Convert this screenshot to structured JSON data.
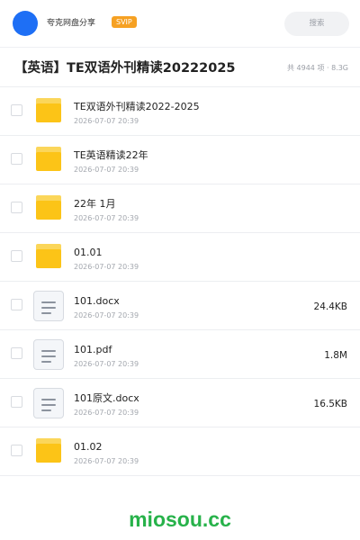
{
  "header": {
    "site_name": "夸克网盘分享",
    "badge": "SVIP",
    "search_label": "搜索"
  },
  "folder": {
    "title": "【英语】TE双语外刊精读20222025",
    "meta": "共 4944 项 · 8.3G"
  },
  "files": [
    {
      "type": "folder",
      "name": "TE双语外刊精读2022-2025",
      "date": "2026-07-07 20:39",
      "size": ""
    },
    {
      "type": "folder",
      "name": "TE英语精读22年",
      "date": "2026-07-07 20:39",
      "size": ""
    },
    {
      "type": "folder",
      "name": "22年 1月",
      "date": "2026-07-07 20:39",
      "size": ""
    },
    {
      "type": "folder",
      "name": "01.01",
      "date": "2026-07-07 20:39",
      "size": ""
    },
    {
      "type": "document",
      "name": "101.docx",
      "date": "2026-07-07 20:39",
      "size": "24.4KB"
    },
    {
      "type": "document",
      "name": "101.pdf",
      "date": "2026-07-07 20:39",
      "size": "1.8M"
    },
    {
      "type": "document",
      "name": "101原文.docx",
      "date": "2026-07-07 20:39",
      "size": "16.5KB"
    },
    {
      "type": "folder",
      "name": "01.02",
      "date": "2026-07-07 20:39",
      "size": ""
    }
  ],
  "watermark": "miosou.cc",
  "colors": {
    "avatar": "#1e6ff5",
    "badge": "#f6a123",
    "folder": "#fcc417",
    "watermark": "#27b24a"
  }
}
